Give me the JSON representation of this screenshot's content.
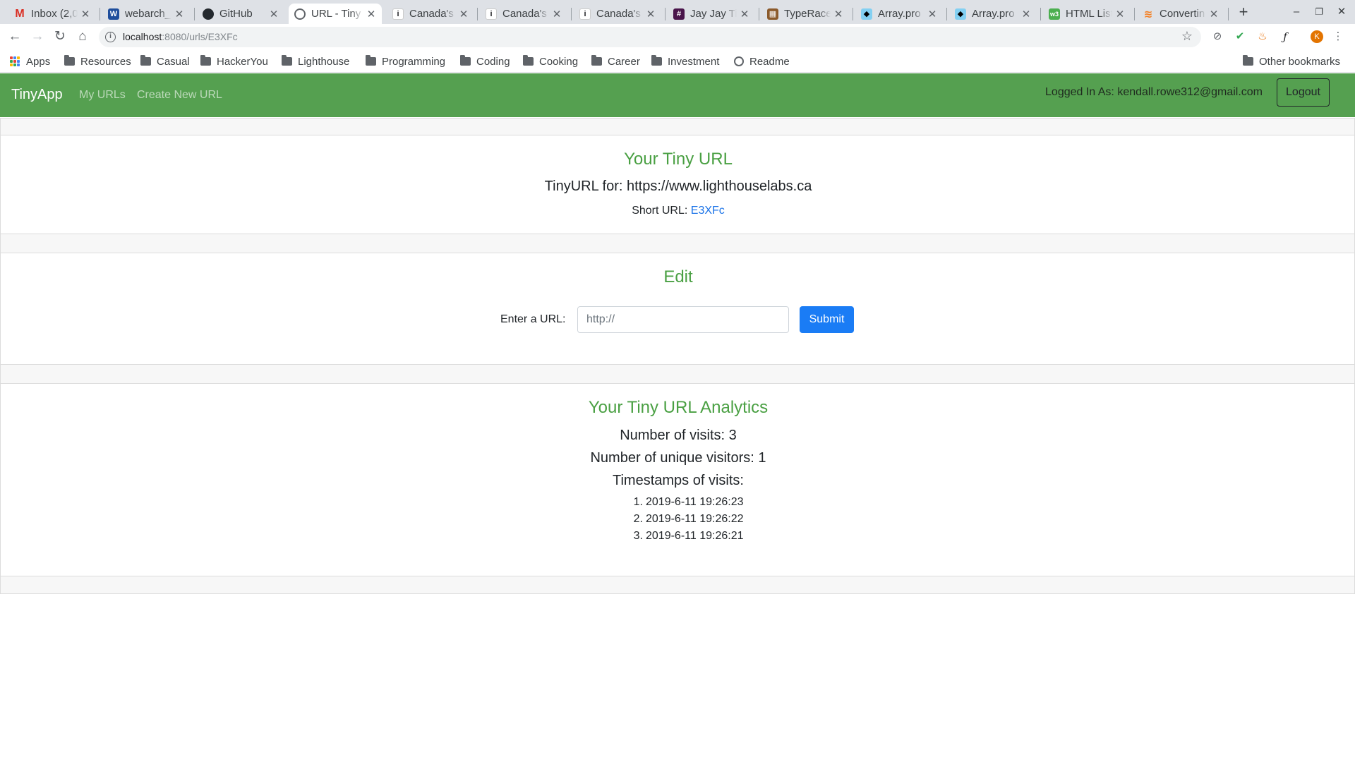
{
  "browser": {
    "tabs": [
      {
        "title": "Inbox (2,0",
        "icon": "gmail-icon"
      },
      {
        "title": "webarch_",
        "icon": "webarch-icon"
      },
      {
        "title": "GitHub",
        "icon": "github-icon"
      },
      {
        "title": "URL - Tiny",
        "icon": "globe-icon",
        "active": true
      },
      {
        "title": "Canada's",
        "icon": "info-icon"
      },
      {
        "title": "Canada's",
        "icon": "info-icon"
      },
      {
        "title": "Canada's",
        "icon": "info-icon"
      },
      {
        "title": "Jay Jay Tir",
        "icon": "grid-icon"
      },
      {
        "title": "TypeRace",
        "icon": "typeracer-icon"
      },
      {
        "title": "Array.pro",
        "icon": "mdn-icon"
      },
      {
        "title": "Array.pro",
        "icon": "mdn-icon"
      },
      {
        "title": "HTML List",
        "icon": "w3-icon"
      },
      {
        "title": "Convertin",
        "icon": "stackoverflow-icon"
      }
    ],
    "address": {
      "host": "localhost",
      "path": ":8080/urls/E3XFc"
    },
    "avatar_initial": "K",
    "bookmarks": [
      "Apps",
      "Resources",
      "Casual",
      "HackerYou",
      "Lighthouse",
      "Programming",
      "Coding",
      "Cooking",
      "Career",
      "Investment",
      "Readme"
    ],
    "other_bookmarks": "Other bookmarks"
  },
  "navbar": {
    "brand": "TinyApp",
    "links": [
      "My URLs",
      "Create New URL"
    ],
    "logged_in": "Logged In As: kendall.rowe312@gmail.com",
    "logout_label": "Logout",
    "color": "#55a050"
  },
  "tiny_url": {
    "heading": "Your Tiny URL",
    "for_line": "TinyURL for: https://www.lighthouselabs.ca",
    "short_label": "Short URL:",
    "short_code": "E3XFc"
  },
  "edit": {
    "heading": "Edit",
    "label": "Enter a URL:",
    "placeholder": "http://",
    "submit_label": "Submit"
  },
  "analytics": {
    "heading": "Your Tiny URL Analytics",
    "visits": "Number of visits: 3",
    "unique": "Number of unique visitors: 1",
    "timestamps_label": "Timestamps of visits:",
    "timestamps": [
      "2019-6-11 19:26:23",
      "2019-6-11 19:26:22",
      "2019-6-11 19:26:21"
    ]
  },
  "colors": {
    "accent_green": "#4aa043",
    "link_blue": "#1a73e8",
    "submit_blue": "#1a7cf5"
  }
}
